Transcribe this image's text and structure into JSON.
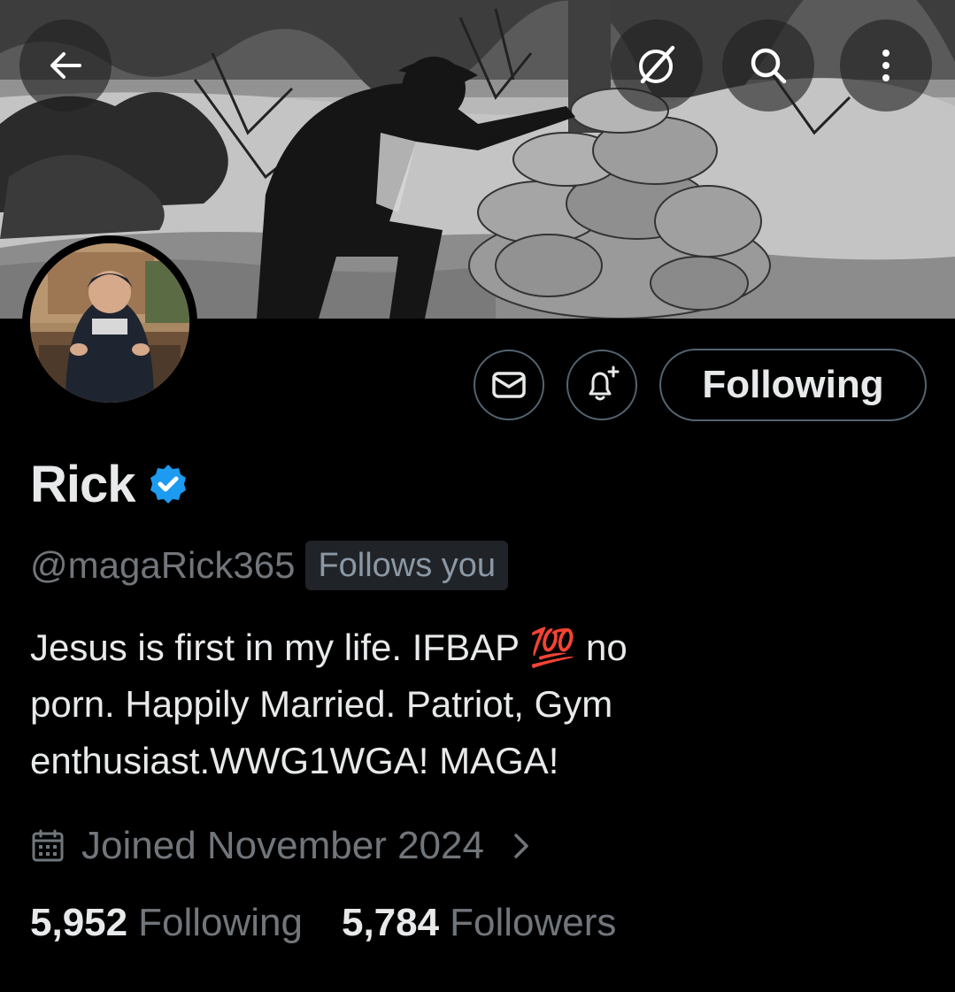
{
  "profile": {
    "name": "Rick",
    "handle": "@magaRick365",
    "follows_you_label": "Follows you",
    "bio_lines": [
      "Jesus is first in my life. IFBAP 💯 no",
      "porn. Happily Married. Patriot, Gym",
      "enthusiast.WWG1WGA! MAGA!"
    ],
    "joined": "Joined November 2024",
    "verified": true
  },
  "actions": {
    "following_label": "Following"
  },
  "stats": {
    "following_count": "5,952",
    "following_label": "Following",
    "followers_count": "5,784",
    "followers_label": "Followers"
  },
  "colors": {
    "background": "#000000",
    "text_primary": "#e7e9ea",
    "text_secondary": "#71767b",
    "verified_blue": "#1d9bf0",
    "border": "#536471",
    "badge_bg": "#202327"
  },
  "icons": {
    "back": "back-arrow-icon",
    "grok": "grok-icon",
    "search": "search-icon",
    "more": "more-vertical-icon",
    "message": "mail-icon",
    "notify": "bell-plus-icon",
    "verified": "verified-badge-icon",
    "calendar": "calendar-icon",
    "chevron": "chevron-right-icon"
  }
}
